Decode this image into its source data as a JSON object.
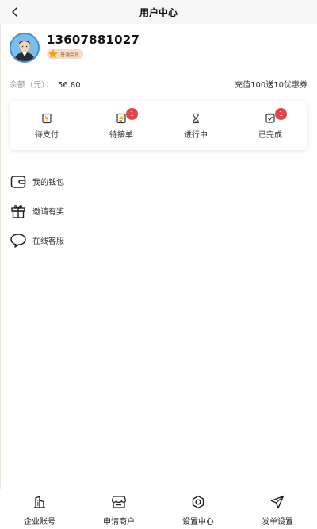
{
  "header": {
    "title": "用户中心"
  },
  "profile": {
    "phone": "13607881027",
    "member_label": "普通会员"
  },
  "balance": {
    "label": "余额（元）：",
    "value": "56.80",
    "promo": "充值100送10优惠券"
  },
  "orders": [
    {
      "label": "待支付",
      "badge": ""
    },
    {
      "label": "待接单",
      "badge": "1"
    },
    {
      "label": "进行中",
      "badge": ""
    },
    {
      "label": "已完成",
      "badge": "1"
    }
  ],
  "menu": [
    {
      "label": "我的钱包",
      "icon": "wallet-icon"
    },
    {
      "label": "邀请有奖",
      "icon": "gift-icon"
    },
    {
      "label": "在线客服",
      "icon": "chat-bubble-icon"
    }
  ],
  "nav": [
    {
      "label": "企业账号",
      "icon": "building-icon"
    },
    {
      "label": "申请商户",
      "icon": "store-icon"
    },
    {
      "label": "设置中心",
      "icon": "gear-icon"
    },
    {
      "label": "发单设置",
      "icon": "paper-plane-icon"
    }
  ],
  "colors": {
    "accent_gold": "#f0a21a",
    "badge_red": "#e0454a",
    "avatar_border": "#3b8fd6"
  }
}
